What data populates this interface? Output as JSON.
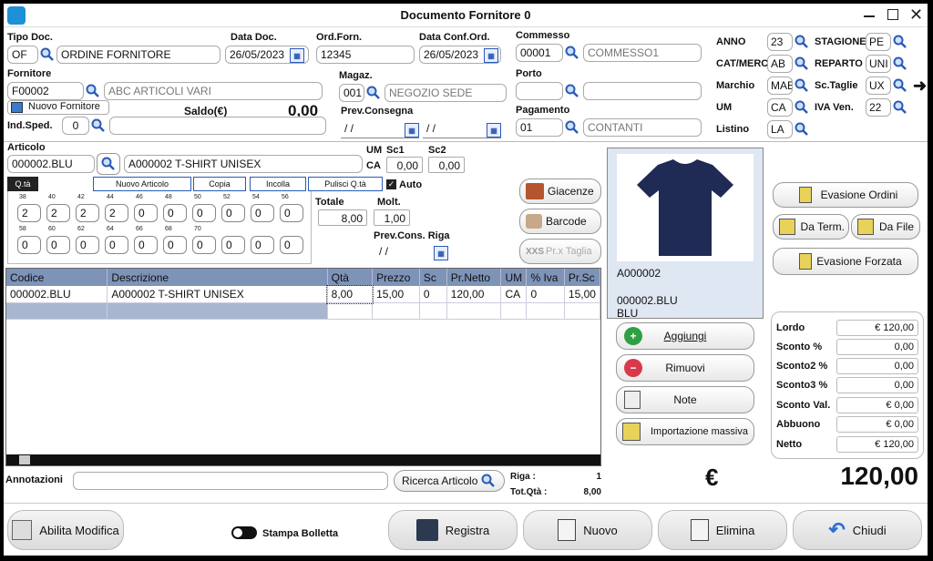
{
  "window": {
    "title": "Documento Fornitore 0"
  },
  "header": {
    "tipo_doc": {
      "label": "Tipo Doc.",
      "code": "OF",
      "desc": "ORDINE FORNITORE"
    },
    "data_doc": {
      "label": "Data Doc.",
      "value": "26/05/2023"
    },
    "ord_forn": {
      "label": "Ord.Forn.",
      "value": "12345"
    },
    "data_conf": {
      "label": "Data Conf.Ord.",
      "value": "26/05/2023"
    },
    "commesso": {
      "label": "Commesso",
      "code": "00001",
      "desc": "COMMESSO1"
    },
    "fornitore": {
      "label": "Fornitore",
      "code": "F00002",
      "desc": "ABC ARTICOLI VARI",
      "new_label": "Nuovo Fornitore"
    },
    "magaz": {
      "label": "Magaz.",
      "code": "001",
      "desc": "NEGOZIO SEDE"
    },
    "porto": {
      "label": "Porto",
      "code": "",
      "desc": ""
    },
    "saldo": {
      "label": "Saldo(€)",
      "value": "0,00"
    },
    "ind_sped": {
      "label": "Ind.Sped.",
      "code": "0",
      "desc": ""
    },
    "prev_consegna": {
      "label": "Prev.Consegna",
      "v1": "/ /",
      "v2": "/ /"
    },
    "pagamento": {
      "label": "Pagamento",
      "code": "01",
      "desc": "CONTANTI"
    }
  },
  "right_fields": {
    "anno": {
      "label": "ANNO",
      "value": "23"
    },
    "stagione": {
      "label": "STAGIONE",
      "value": "PE"
    },
    "cat": {
      "label": "CAT/MERC",
      "value": "AB"
    },
    "reparto": {
      "label": "REPARTO",
      "value": "UNI"
    },
    "marchio": {
      "label": "Marchio",
      "value": "MAE"
    },
    "sc_taglie": {
      "label": "Sc.Taglie",
      "value": "UX"
    },
    "um": {
      "label": "UM",
      "value": "CA"
    },
    "iva_ven": {
      "label": "IVA Ven.",
      "value": "22"
    },
    "listino": {
      "label": "Listino",
      "value": "LA"
    }
  },
  "articolo": {
    "label": "Articolo",
    "code": "000002.BLU",
    "desc": "A000002 T-SHIRT UNISEX",
    "um_label": "UM",
    "um": "CA",
    "sc1_label": "Sc1",
    "sc1": "0,00",
    "sc2_label": "Sc2",
    "sc2": "0,00",
    "qta_tab": "Q.tà",
    "btn_nuovo": "Nuovo Articolo",
    "btn_copia": "Copia",
    "btn_incolla": "Incolla",
    "btn_pulisci": "Pulisci Q.tà",
    "auto_label": "Auto",
    "sizes1": [
      "38",
      "40",
      "42",
      "44",
      "46",
      "48",
      "50",
      "52",
      "54",
      "56"
    ],
    "qty1": [
      "2",
      "2",
      "2",
      "2",
      "0",
      "0",
      "0",
      "0",
      "0",
      "0"
    ],
    "sizes2": [
      "58",
      "60",
      "62",
      "64",
      "66",
      "68",
      "70",
      "",
      "",
      ""
    ],
    "qty2": [
      "0",
      "0",
      "0",
      "0",
      "0",
      "0",
      "0",
      "0",
      "0",
      "0"
    ],
    "totale_label": "Totale",
    "totale": "8,00",
    "molt_label": "Molt.",
    "molt": "1,00",
    "prev_riga_label": "Prev.Cons. Riga",
    "prev_riga": "/ /"
  },
  "side_buttons": {
    "giacenze": "Giacenze",
    "barcode": "Barcode",
    "prx_taglia": "Pr.x Taglia"
  },
  "preview": {
    "code": "A000002",
    "variant": "000002.BLU",
    "color": "BLU"
  },
  "actions": {
    "aggiungi": "Aggiungi",
    "rimuovi": "Rimuovi",
    "note": "Note",
    "import": "Importazione massiva"
  },
  "right_buttons": {
    "evasione": "Evasione Ordini",
    "da_term": "Da Term.",
    "da_file": "Da File",
    "forzata": "Evasione Forzata"
  },
  "table": {
    "headers": [
      "Codice",
      "Descrizione",
      "Qtà",
      "Prezzo",
      "Sc",
      "Pr.Netto",
      "UM",
      "% Iva",
      "Pr.Sc"
    ],
    "rows": [
      [
        "000002.BLU",
        "A000002 T-SHIRT UNISEX",
        "8,00",
        "15,00",
        "0",
        "120,00",
        "CA",
        "0",
        "15,00"
      ]
    ]
  },
  "totals": {
    "lordo": {
      "label": "Lordo",
      "value": "€ 120,00"
    },
    "sconto": {
      "label": "Sconto %",
      "value": "0,00"
    },
    "sconto2": {
      "label": "Sconto2 %",
      "value": "0,00"
    },
    "sconto3": {
      "label": "Sconto3 %",
      "value": "0,00"
    },
    "sconto_val": {
      "label": "Sconto Val.",
      "value": "€ 0,00"
    },
    "abbuono": {
      "label": "Abbuono",
      "value": "€ 0,00"
    },
    "netto": {
      "label": "Netto",
      "value": "€ 120,00"
    },
    "currency": "€",
    "grand": "120,00"
  },
  "footer": {
    "annotazioni_label": "Annotazioni",
    "ricerca": "Ricerca Articolo",
    "riga_label": "Riga :",
    "riga": "1",
    "totqta_label": "Tot.Qtà :",
    "totqta": "8,00",
    "abilita": "Abilita Modifica",
    "stampa": "Stampa Bolletta",
    "registra": "Registra",
    "nuovo": "Nuovo",
    "elimina": "Elimina",
    "chiudi": "Chiudi"
  }
}
